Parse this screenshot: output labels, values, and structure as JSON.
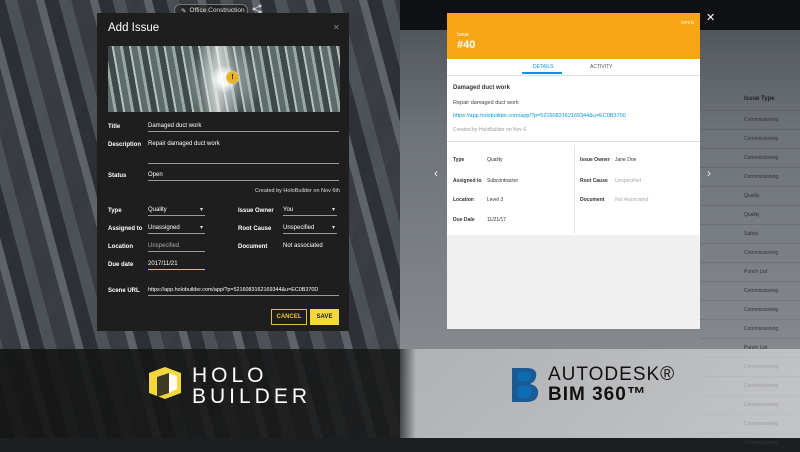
{
  "top_bar": {
    "project_name": "Office Construction"
  },
  "add_issue": {
    "title": "Add Issue",
    "fields": {
      "title_label": "Title",
      "title_value": "Damaged duct work",
      "description_label": "Description",
      "description_value": "Repair damaged duct work",
      "status_label": "Status",
      "status_value": "Open",
      "created_by": "Created by HoloBuilder on Nov 6th",
      "type_label": "Type",
      "type_value": "Quality",
      "issue_owner_label": "Issue Owner",
      "issue_owner_value": "You",
      "assigned_to_label": "Assigned to",
      "assigned_to_value": "Unassigned",
      "root_cause_label": "Root Cause",
      "root_cause_value": "Unspecified",
      "location_label": "Location",
      "location_value": "Unspecified",
      "document_label": "Document",
      "document_value": "Not associated",
      "due_date_label": "Due date",
      "due_date_value": "2017/11/21",
      "scene_url_label": "Scene URL",
      "scene_url_value": "https://app.holobuilder.com/app/?p=5216083162169344&u=EC0B370D"
    },
    "cancel_label": "CANCEL",
    "save_label": "SAVE",
    "pin_label": "!"
  },
  "bim_panel": {
    "header_label": "Issue",
    "header_number": "#40",
    "header_status": "OPEN",
    "tabs": [
      "DETAILS",
      "ACTIVITY"
    ],
    "title": "Damaged duct work",
    "description": "Repair damaged duct work",
    "link": "https://app.holobuilder.com/app/?p=5216083162169344&u=EC0B3700",
    "created": "Created by HoloBuilder on Nov 6",
    "left_fields": [
      {
        "k": "Type",
        "v": "Quality"
      },
      {
        "k": "Assigned to",
        "v": "Subcontractor"
      },
      {
        "k": "Location",
        "v": "Level 3"
      },
      {
        "k": "Due Date",
        "v": "11/21/17"
      }
    ],
    "right_fields": [
      {
        "k": "Issue Owner",
        "v": "Jane Doe"
      },
      {
        "k": "Root Cause",
        "v": "Unspecified"
      },
      {
        "k": "Document",
        "v": "Not Associated"
      }
    ]
  },
  "issue_table": {
    "header": "Issue Type",
    "rows": [
      "Commissioning",
      "Commissioning",
      "Commissioning",
      "Commissioning",
      "Quality",
      "Quality",
      "Safety",
      "Commissioning",
      "Punch List",
      "Commissioning",
      "Commissioning",
      "Commissioning",
      "Punch List",
      "Commissioning",
      "Commissioning",
      "Commissioning",
      "Commissioning",
      "Commissioning"
    ]
  },
  "logos": {
    "holobuilder_line1": "HOLO",
    "holobuilder_line2": "BUILDER",
    "autodesk": "AUTODESK®",
    "bim360": "BIM 360™"
  },
  "colors": {
    "bim_orange": "#f6a615",
    "accent_blue": "#0696d7",
    "holo_yellow": "#f2d83c"
  }
}
